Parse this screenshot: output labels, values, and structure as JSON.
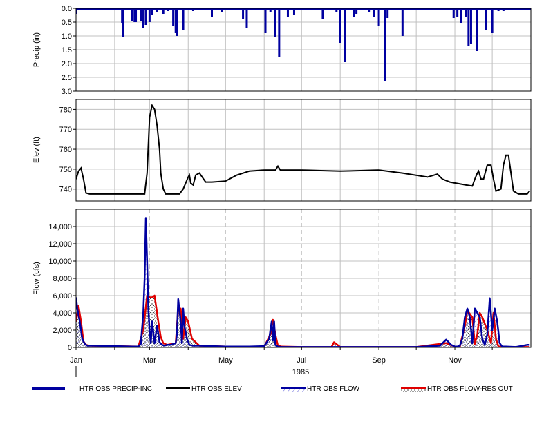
{
  "chart_data": [
    {
      "type": "bar",
      "ylabel": "Precip (in)",
      "ylim": [
        0,
        3
      ],
      "y_inverted": true,
      "yticks": [
        "0.0",
        "0.5",
        "1.0",
        "1.5",
        "2.0",
        "2.5",
        "3.0"
      ],
      "grid": true,
      "color": "#0000a0",
      "series": [
        {
          "name": "HTR OBS PRECIP-INC",
          "x": [
            "1985-01-01",
            "1985-01-15",
            "1985-02-07",
            "1985-02-08",
            "1985-02-15",
            "1985-02-17",
            "1985-02-18",
            "1985-02-22",
            "1985-02-24",
            "1985-02-26",
            "1985-03-01",
            "1985-03-03",
            "1985-03-07",
            "1985-03-12",
            "1985-03-16",
            "1985-03-20",
            "1985-03-22",
            "1985-03-23",
            "1985-03-28",
            "1985-04-05",
            "1985-04-20",
            "1985-04-28",
            "1985-05-15",
            "1985-05-18",
            "1985-06-02",
            "1985-06-06",
            "1985-06-10",
            "1985-06-13",
            "1985-06-20",
            "1985-06-25",
            "1985-07-09",
            "1985-07-18",
            "1985-07-29",
            "1985-08-01",
            "1985-08-05",
            "1985-08-12",
            "1985-08-14",
            "1985-08-24",
            "1985-08-28",
            "1985-09-01",
            "1985-09-06",
            "1985-09-08",
            "1985-09-20",
            "1985-10-10",
            "1985-10-20",
            "1985-10-25",
            "1985-10-31",
            "1985-11-03",
            "1985-11-06",
            "1985-11-10",
            "1985-11-12",
            "1985-11-14",
            "1985-11-19",
            "1985-11-26",
            "1985-12-01",
            "1985-12-06",
            "1985-12-10"
          ],
          "values": [
            0.2,
            0.05,
            0.55,
            1.05,
            0.45,
            0.5,
            0.5,
            0.45,
            0.7,
            0.6,
            0.5,
            0.25,
            0.15,
            0.2,
            0.1,
            0.65,
            0.9,
            1.0,
            0.8,
            0.1,
            0.3,
            0.15,
            0.4,
            0.7,
            0.9,
            0.15,
            1.05,
            1.75,
            0.3,
            0.25,
            0.05,
            0.4,
            0.15,
            1.25,
            1.95,
            0.3,
            0.2,
            0.15,
            0.3,
            0.65,
            2.65,
            0.35,
            1.0,
            0.05,
            0.05,
            0.05,
            0.35,
            0.3,
            0.55,
            0.3,
            1.35,
            1.3,
            1.55,
            0.8,
            0.9,
            0.1,
            0.1
          ]
        }
      ]
    },
    {
      "type": "line",
      "ylabel": "Elev (ft)",
      "ylim": [
        734,
        785
      ],
      "yticks": [
        "740",
        "750",
        "760",
        "770",
        "780"
      ],
      "grid": true,
      "series": [
        {
          "name": "HTR OBS ELEV",
          "color": "#000000",
          "x": [
            "1985-01-01",
            "1985-01-03",
            "1985-01-05",
            "1985-01-07",
            "1985-01-09",
            "1985-01-12",
            "1985-01-20",
            "1985-02-01",
            "1985-02-15",
            "1985-02-25",
            "1985-02-27",
            "1985-03-01",
            "1985-03-03",
            "1985-03-05",
            "1985-03-07",
            "1985-03-09",
            "1985-03-10",
            "1985-03-12",
            "1985-03-14",
            "1985-03-20",
            "1985-03-25",
            "1985-03-28",
            "1985-04-01",
            "1985-04-02",
            "1985-04-03",
            "1985-04-05",
            "1985-04-07",
            "1985-04-10",
            "1985-04-15",
            "1985-04-20",
            "1985-05-01",
            "1985-05-10",
            "1985-05-20",
            "1985-06-01",
            "1985-06-10",
            "1985-06-12",
            "1985-06-14",
            "1985-06-20",
            "1985-07-01",
            "1985-08-01",
            "1985-09-01",
            "1985-09-20",
            "1985-10-10",
            "1985-10-18",
            "1985-10-22",
            "1985-10-28",
            "1985-11-10",
            "1985-11-15",
            "1985-11-17",
            "1985-11-19",
            "1985-11-20",
            "1985-11-22",
            "1985-11-24",
            "1985-11-27",
            "1985-11-30",
            "1985-12-02",
            "1985-12-04",
            "1985-12-08",
            "1985-12-10",
            "1985-12-12",
            "1985-12-14",
            "1985-12-16",
            "1985-12-18",
            "1985-12-22",
            "1985-12-29",
            "1985-12-31"
          ],
          "values": [
            745,
            749,
            750.5,
            745,
            738,
            737.5,
            737.5,
            737.5,
            737.5,
            737.5,
            748,
            776,
            782,
            780,
            772,
            760,
            748,
            740,
            737.5,
            737.5,
            737.5,
            740,
            746,
            747,
            743,
            742,
            747,
            748,
            743.5,
            743.5,
            744,
            747,
            749,
            749.5,
            749.5,
            751.5,
            749.5,
            749.5,
            749.5,
            749,
            749.5,
            748,
            746,
            747.5,
            745,
            743.5,
            742,
            741.5,
            745,
            748,
            749,
            745,
            745,
            752,
            752,
            745,
            739,
            740,
            752,
            757,
            757,
            748,
            739,
            737.5,
            737.5,
            739
          ]
        }
      ]
    },
    {
      "type": "area",
      "ylabel": "Flow (cfs)",
      "xlabel": "1985",
      "ylim": [
        0,
        16000
      ],
      "yticks": [
        "0",
        "2,000",
        "4,000",
        "6,000",
        "8,000",
        "10,000",
        "12,000",
        "14,000"
      ],
      "xticks": [
        "Jan",
        "Mar",
        "May",
        "Jul",
        "Sep",
        "Nov"
      ],
      "grid": true,
      "series": [
        {
          "name": "HTR OBS FLOW",
          "color": "#0000a0",
          "style": "blue line with blue diagonal hatch fill",
          "x": [
            "1985-01-01",
            "1985-01-02",
            "1985-01-04",
            "1985-01-06",
            "1985-01-08",
            "1985-01-10",
            "1985-01-15",
            "1985-02-01",
            "1985-02-15",
            "1985-02-20",
            "1985-02-22",
            "1985-02-24",
            "1985-02-25",
            "1985-02-26",
            "1985-02-27",
            "1985-02-28",
            "1985-03-01",
            "1985-03-02",
            "1985-03-03",
            "1985-03-05",
            "1985-03-07",
            "1985-03-09",
            "1985-03-11",
            "1985-03-13",
            "1985-03-15",
            "1985-03-18",
            "1985-03-22",
            "1985-03-23",
            "1985-03-24",
            "1985-03-26",
            "1985-03-27",
            "1985-03-28",
            "1985-03-29",
            "1985-03-31",
            "1985-04-02",
            "1985-04-05",
            "1985-04-10",
            "1985-05-01",
            "1985-05-20",
            "1985-06-01",
            "1985-06-05",
            "1985-06-07",
            "1985-06-08",
            "1985-06-09",
            "1985-06-10",
            "1985-06-12",
            "1985-06-15",
            "1985-07-01",
            "1985-08-01",
            "1985-09-01",
            "1985-10-01",
            "1985-10-20",
            "1985-10-25",
            "1985-10-29",
            "1985-11-01",
            "1985-11-03",
            "1985-11-05",
            "1985-11-07",
            "1985-11-09",
            "1985-11-11",
            "1985-11-13",
            "1985-11-15",
            "1985-11-17",
            "1985-11-19",
            "1985-11-21",
            "1985-11-23",
            "1985-11-25",
            "1985-11-27",
            "1985-11-29",
            "1985-12-01",
            "1985-12-03",
            "1985-12-05",
            "1985-12-07",
            "1985-12-09",
            "1985-12-12",
            "1985-12-20",
            "1985-12-29",
            "1985-12-31"
          ],
          "values": [
            5800,
            4500,
            3000,
            1000,
            400,
            200,
            200,
            150,
            100,
            100,
            400,
            4000,
            8000,
            15000,
            10000,
            4500,
            2000,
            500,
            3000,
            500,
            2500,
            600,
            300,
            200,
            300,
            300,
            500,
            1500,
            5600,
            3000,
            500,
            4500,
            2500,
            1000,
            300,
            200,
            200,
            100,
            100,
            150,
            1000,
            3000,
            800,
            3000,
            300,
            100,
            50,
            50,
            50,
            50,
            50,
            200,
            900,
            300,
            100,
            100,
            200,
            1000,
            3500,
            4500,
            3500,
            500,
            4500,
            4000,
            3500,
            1000,
            300,
            1500,
            5700,
            2000,
            4500,
            3000,
            500,
            100,
            100,
            50,
            300,
            300
          ]
        },
        {
          "name": "HTR OBS FLOW-RES OUT",
          "color": "#e00000",
          "style": "red line with dark crosshatch fill",
          "x": [
            "1985-01-01",
            "1985-01-03",
            "1985-01-05",
            "1985-01-07",
            "1985-01-09",
            "1985-01-12",
            "1985-02-01",
            "1985-02-20",
            "1985-02-24",
            "1985-02-27",
            "1985-02-28",
            "1985-03-01",
            "1985-03-03",
            "1985-03-05",
            "1985-03-08",
            "1985-03-10",
            "1985-03-12",
            "1985-03-15",
            "1985-03-22",
            "1985-03-24",
            "1985-03-26",
            "1985-03-28",
            "1985-03-30",
            "1985-04-01",
            "1985-04-04",
            "1985-04-10",
            "1985-05-01",
            "1985-06-01",
            "1985-06-06",
            "1985-06-08",
            "1985-06-10",
            "1985-06-12",
            "1985-06-15",
            "1985-07-01",
            "1985-07-25",
            "1985-07-27",
            "1985-08-01",
            "1985-10-01",
            "1985-10-25",
            "1985-11-01",
            "1985-11-05",
            "1985-11-09",
            "1985-11-11",
            "1985-11-15",
            "1985-11-17",
            "1985-11-19",
            "1985-11-21",
            "1985-11-23",
            "1985-11-27",
            "1985-11-30",
            "1985-12-02",
            "1985-12-04",
            "1985-12-06",
            "1985-12-08",
            "1985-12-12",
            "1985-12-20",
            "1985-12-29",
            "1985-12-31"
          ],
          "values": [
            3000,
            4800,
            3000,
            700,
            300,
            200,
            150,
            100,
            2000,
            6000,
            6000,
            5800,
            5800,
            6000,
            3000,
            1200,
            500,
            300,
            500,
            4500,
            4500,
            1000,
            3500,
            3000,
            1000,
            200,
            100,
            100,
            1500,
            3200,
            1500,
            200,
            100,
            50,
            50,
            600,
            50,
            50,
            500,
            100,
            100,
            2500,
            4300,
            3500,
            400,
            1500,
            4000,
            3500,
            2000,
            500,
            4000,
            1000,
            100,
            100,
            50,
            50,
            50,
            50
          ]
        }
      ]
    }
  ],
  "legend": [
    {
      "label": "HTR OBS PRECIP-INC",
      "color": "#0000a0",
      "symbol": "thick-bar"
    },
    {
      "label": "HTR OBS ELEV",
      "color": "#000000",
      "symbol": "line"
    },
    {
      "label": "HTR OBS FLOW",
      "color": "#0000a0",
      "symbol": "hatch"
    },
    {
      "label": "HTR OBS FLOW-RES OUT",
      "color": "#e00000",
      "symbol": "crosshatch"
    }
  ]
}
